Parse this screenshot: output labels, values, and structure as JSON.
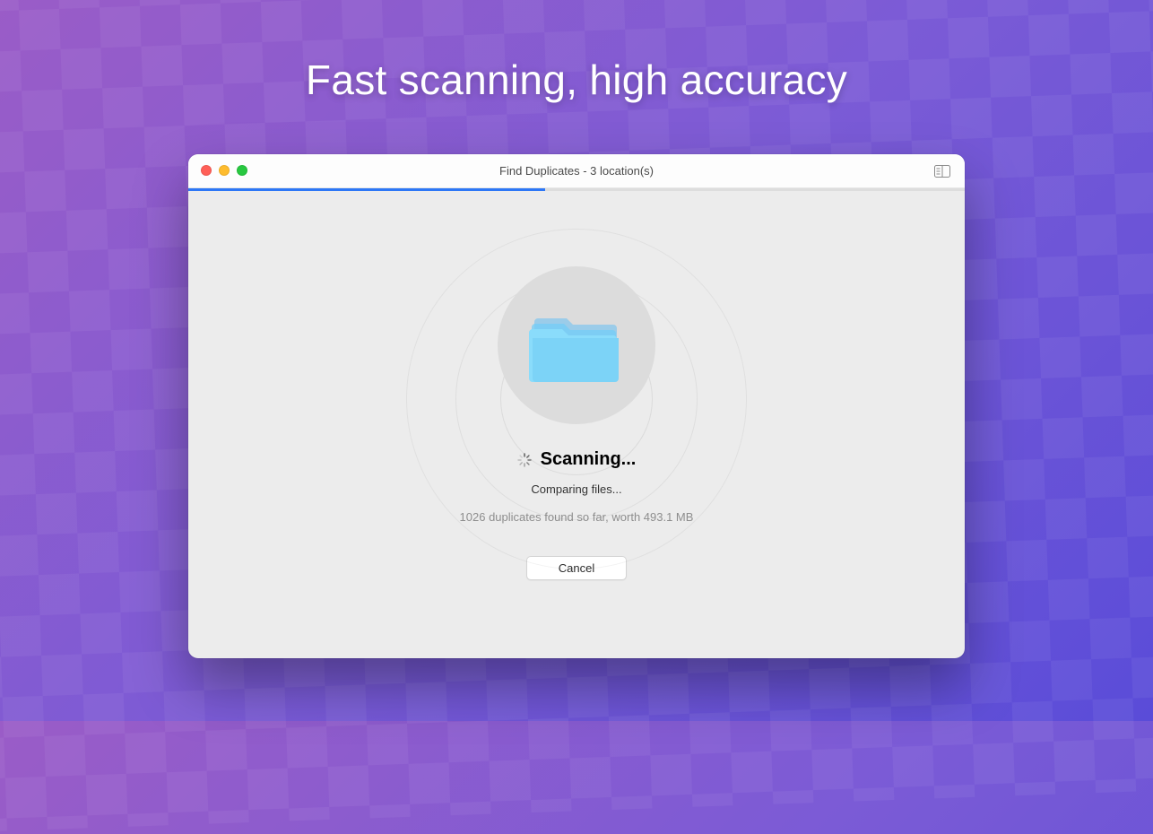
{
  "headline": "Fast scanning, high accuracy",
  "window": {
    "title": "Find Duplicates - 3 location(s)",
    "progress_percent": 46
  },
  "scan": {
    "status_title": "Scanning...",
    "status_subtitle": "Comparing files...",
    "status_detail": "1026 duplicates found so far, worth 493.1 MB",
    "cancel_label": "Cancel"
  },
  "colors": {
    "accent": "#2d77f6"
  }
}
